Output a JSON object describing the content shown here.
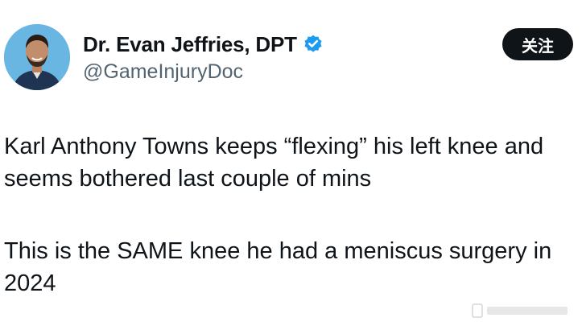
{
  "author": {
    "display_name": "Dr. Evan Jeffries, DPT",
    "handle": "@GameInjuryDoc",
    "verified_icon": "verified-badge-icon",
    "avatar_icon": "profile-avatar"
  },
  "follow_button": {
    "label": "关注"
  },
  "tweet": {
    "paragraph_1": "Karl Anthony Towns keeps “flexing” his left knee and seems bothered last couple of mins",
    "paragraph_2": "This is the SAME knee he had a meniscus surgery in 2024"
  },
  "colors": {
    "text": "#0f1419",
    "secondary_text": "#536471",
    "verified_blue": "#1d9bf0",
    "follow_bg": "#0f1419",
    "avatar_bg": "#6ab6e3"
  }
}
